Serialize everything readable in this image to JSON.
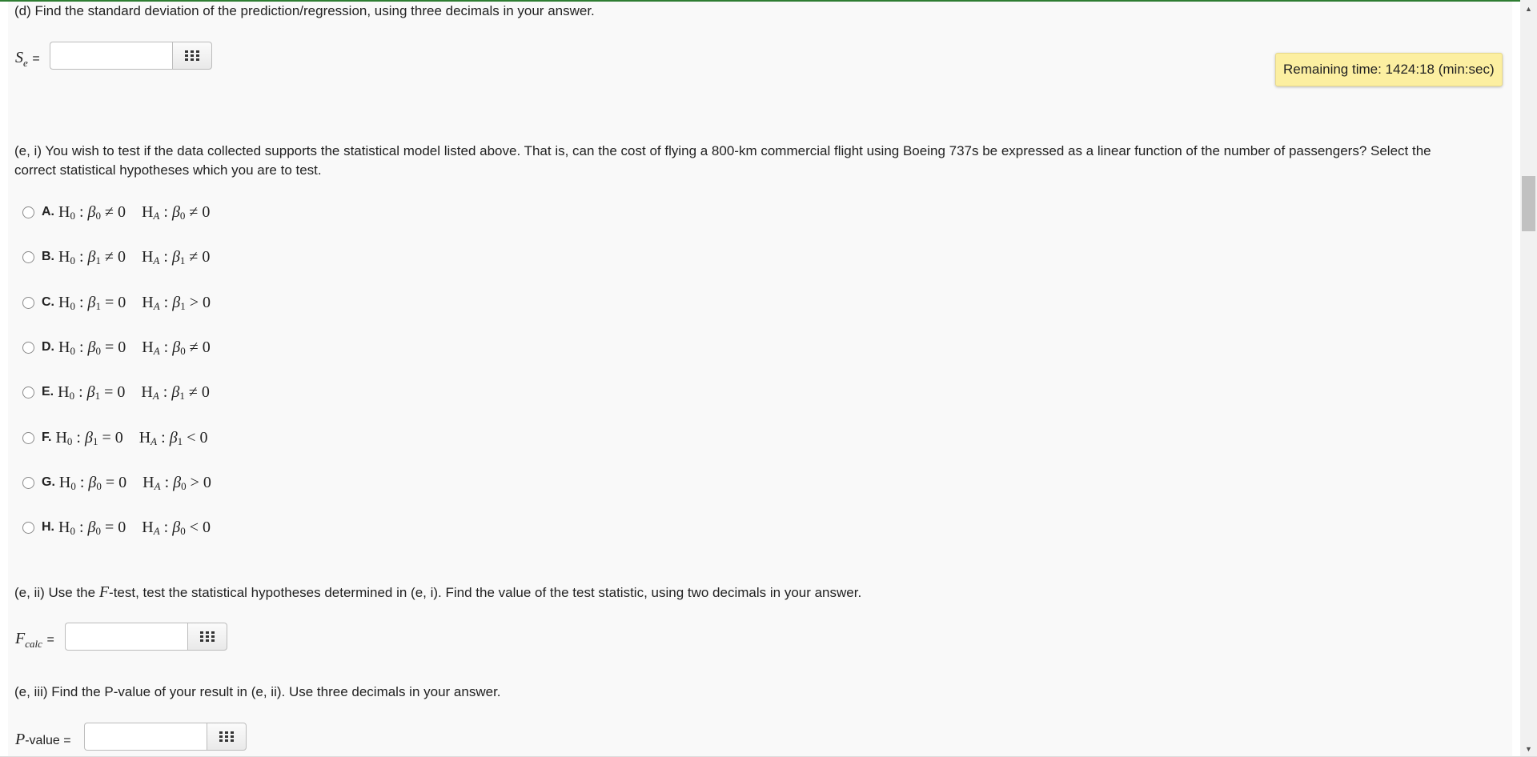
{
  "part_d": {
    "question": "(d) Find the standard deviation of the prediction/regression, using three decimals in your answer.",
    "label_var": "S",
    "label_sub": "e",
    "label_eq": "=",
    "value": ""
  },
  "timer": {
    "text": "Remaining time: 1424:18 (min:sec)"
  },
  "part_e_i": {
    "question_line1": "(e, i) You wish to test if the data collected supports the statistical model listed above. That is, can the cost of flying a 800-km commercial flight using Boeing 737s be expressed as a linear function of the number of passengers? Select the",
    "question_line2": "correct statistical hypotheses which you are to test.",
    "options": [
      {
        "letter": "A.",
        "h0_beta": "0",
        "h0_rel": "≠",
        "ha_beta": "0",
        "ha_rel": "≠"
      },
      {
        "letter": "B.",
        "h0_beta": "1",
        "h0_rel": "≠",
        "ha_beta": "1",
        "ha_rel": "≠"
      },
      {
        "letter": "C.",
        "h0_beta": "1",
        "h0_rel": "=",
        "ha_beta": "1",
        "ha_rel": ">"
      },
      {
        "letter": "D.",
        "h0_beta": "0",
        "h0_rel": "=",
        "ha_beta": "0",
        "ha_rel": "≠"
      },
      {
        "letter": "E.",
        "h0_beta": "1",
        "h0_rel": "=",
        "ha_beta": "1",
        "ha_rel": "≠"
      },
      {
        "letter": "F.",
        "h0_beta": "1",
        "h0_rel": "=",
        "ha_beta": "1",
        "ha_rel": "<"
      },
      {
        "letter": "G.",
        "h0_beta": "0",
        "h0_rel": "=",
        "ha_beta": "0",
        "ha_rel": ">"
      },
      {
        "letter": "H.",
        "h0_beta": "0",
        "h0_rel": "=",
        "ha_beta": "0",
        "ha_rel": "<"
      }
    ],
    "hyp_h": "H",
    "h0_sub": "0",
    "ha_sub": "A",
    "beta": "β",
    "colon": ":",
    "zero": "0"
  },
  "part_e_ii": {
    "question_before": "(e, ii) Use the ",
    "question_var": "F",
    "question_after": "-test, test the statistical hypotheses determined in (e, i). Find the value of the test statistic, using two decimals in your answer.",
    "label_var": "F",
    "label_sub": "calc",
    "label_eq": "=",
    "value": ""
  },
  "part_e_iii": {
    "question": "(e, iii) Find the P-value of your result in (e, ii). Use three decimals in your answer.",
    "label_var": "P",
    "label_rest": "-value =",
    "value": ""
  },
  "icons": {
    "keypad": "grid-keypad-icon",
    "scroll_up": "scroll-up-arrow-icon",
    "scroll_down": "scroll-down-arrow-icon"
  },
  "colors": {
    "timer_bg": "#fcefa1",
    "page_bg": "#f9f9f9",
    "top_accent": "#2e7d32"
  }
}
